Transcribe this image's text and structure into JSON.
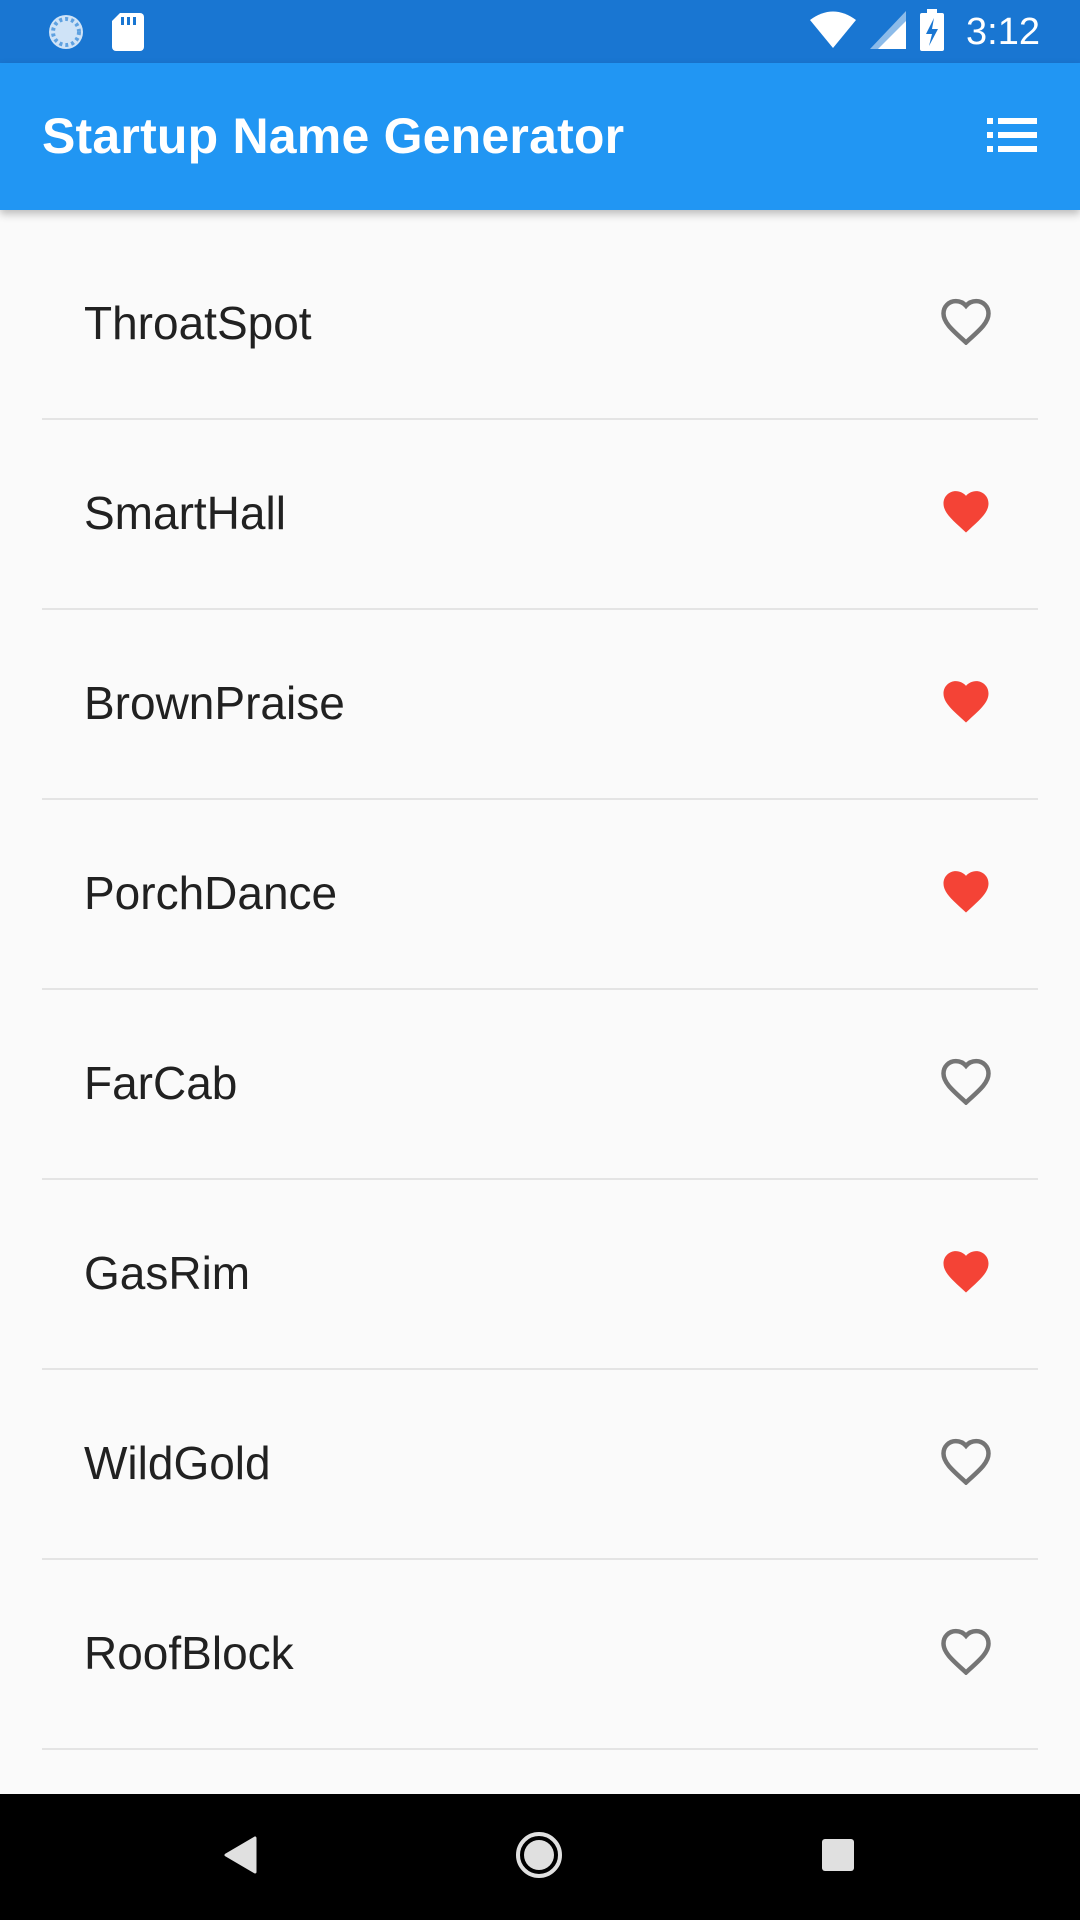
{
  "status_bar": {
    "time": "3:12",
    "icons": [
      "sync-icon",
      "sd-card-icon",
      "wifi-icon",
      "cell-signal-icon",
      "battery-charging-icon"
    ]
  },
  "app_bar": {
    "title": "Startup Name Generator",
    "action_icon": "saved-list-icon"
  },
  "colors": {
    "primary": "#2196f3",
    "primary_dark": "#1976d2",
    "favorite": "#f44336",
    "icon_grey": "#757575"
  },
  "list": {
    "items": [
      {
        "label": "ThroatSpot",
        "favorited": false
      },
      {
        "label": "SmartHall",
        "favorited": true
      },
      {
        "label": "BrownPraise",
        "favorited": true
      },
      {
        "label": "PorchDance",
        "favorited": true
      },
      {
        "label": "FarCab",
        "favorited": false
      },
      {
        "label": "GasRim",
        "favorited": true
      },
      {
        "label": "WildGold",
        "favorited": false
      },
      {
        "label": "RoofBlock",
        "favorited": false
      }
    ]
  },
  "nav_bar": {
    "buttons": [
      "back-icon",
      "home-icon",
      "recents-icon"
    ]
  }
}
